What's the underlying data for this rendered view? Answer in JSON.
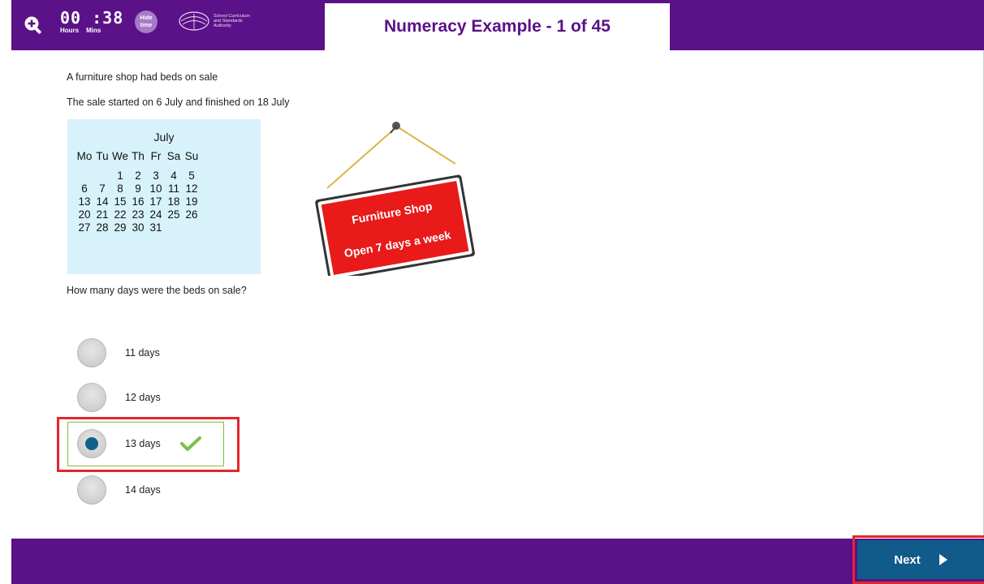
{
  "header": {
    "timer_digits": "00 :38",
    "timer_hours_label": "Hours",
    "timer_mins_label": "Mins",
    "hide_time_label_1": "Hide",
    "hide_time_label_2": "time",
    "logo_line_1": "School Curriculum",
    "logo_line_2": "and Standards",
    "logo_line_3": "Authority",
    "title": "Numeracy Example - 1 of 45",
    "bar_color": "#5b1188"
  },
  "question": {
    "line_1": "A furniture shop had beds on sale",
    "line_2": "The sale started on 6 July and finished on 18 July",
    "prompt": "How many days were the beds on sale?"
  },
  "calendar": {
    "month": "July",
    "weekdays": [
      "Mo",
      "Tu",
      "We",
      "Th",
      "Fr",
      "Sa",
      "Su"
    ],
    "weeks": [
      [
        "",
        "",
        "1",
        "2",
        "3",
        "4",
        "5"
      ],
      [
        "6",
        "7",
        "8",
        "9",
        "10",
        "11",
        "12"
      ],
      [
        "13",
        "14",
        "15",
        "16",
        "17",
        "18",
        "19"
      ],
      [
        "20",
        "21",
        "22",
        "23",
        "24",
        "25",
        "26"
      ],
      [
        "27",
        "28",
        "29",
        "30",
        "31",
        "",
        ""
      ]
    ]
  },
  "sign": {
    "line_1": "Furniture Shop",
    "line_2": "Open 7 days a week",
    "color": "#e81a1a"
  },
  "options": [
    {
      "label": "11 days",
      "selected": false
    },
    {
      "label": "12 days",
      "selected": false
    },
    {
      "label": "13 days",
      "selected": true
    },
    {
      "label": "14 days",
      "selected": false
    }
  ],
  "footer": {
    "next_label": "Next",
    "next_color": "#115b8a"
  }
}
